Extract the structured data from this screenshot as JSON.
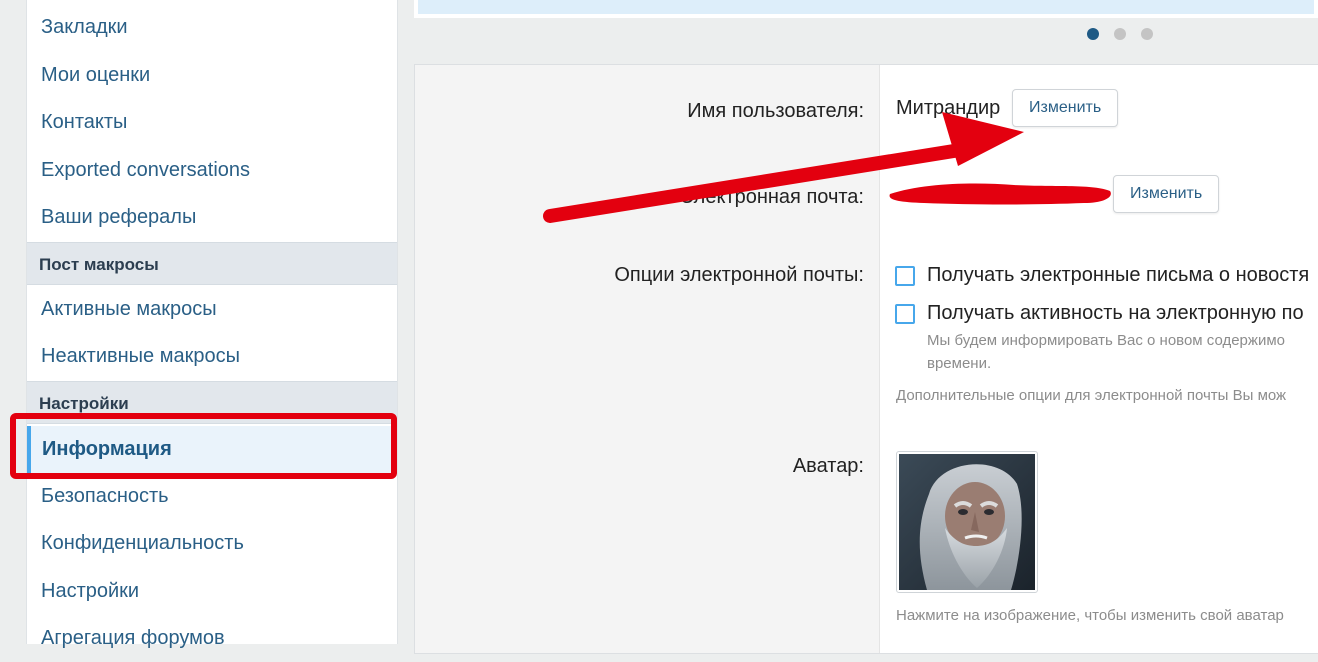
{
  "sidebar": {
    "items": [
      {
        "label": "Закладки"
      },
      {
        "label": "Мои оценки"
      },
      {
        "label": "Контакты"
      },
      {
        "label": "Exported conversations"
      },
      {
        "label": "Ваши рефералы"
      }
    ],
    "section_macros": {
      "title": "Пост макросы",
      "items": [
        {
          "label": "Активные макросы"
        },
        {
          "label": "Неактивные макросы"
        }
      ]
    },
    "section_settings": {
      "title": "Настройки",
      "items": [
        {
          "label": "Информация",
          "active": true
        },
        {
          "label": "Безопасность"
        },
        {
          "label": "Конфиденциальность"
        },
        {
          "label": "Настройки"
        },
        {
          "label": "Агрегация форумов"
        }
      ]
    }
  },
  "carousel": {
    "active_index": 0,
    "dot_count": 3
  },
  "form": {
    "username": {
      "label": "Имя пользователя:",
      "value": "Митрандир",
      "button": "Изменить"
    },
    "email": {
      "label": "Электронная почта:",
      "value_redacted": true,
      "button": "Изменить"
    },
    "email_options": {
      "label": "Опции электронной почты:",
      "option1": "Получать электронные письма о новостя",
      "option2": "Получать активность на электронную по",
      "option2_hint_line1": "Мы будем информировать Вас о новом содержимо",
      "option2_hint_line2": "времени.",
      "extra_hint": "Дополнительные опции для электронной почты Вы мож"
    },
    "avatar": {
      "label": "Аватар:",
      "hint": "Нажмите на изображение, чтобы изменить свой аватар"
    }
  },
  "colors": {
    "accent": "#47a7eb",
    "link": "#2a5f86",
    "annotation": "#e3000f"
  },
  "icons": {
    "annotation": "arrow-icon"
  }
}
